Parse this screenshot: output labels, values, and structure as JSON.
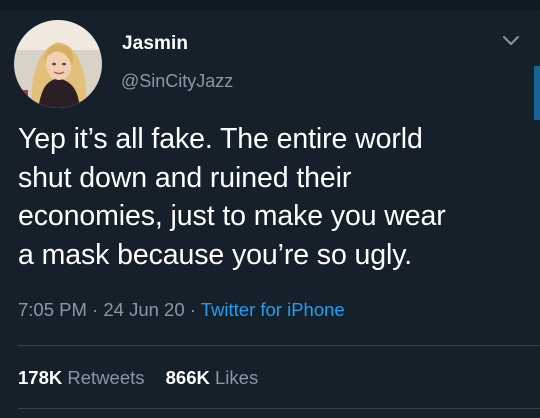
{
  "tweet": {
    "author": {
      "display_name": "Jasmin",
      "handle": "@SinCityJazz",
      "avatar_icon": "profile-photo"
    },
    "text_lines": [
      "Yep it’s all fake. The entire world",
      "shut down and ruined their",
      "economies, just to make you wear",
      "a mask because you’re so ugly."
    ],
    "time": "7:05 PM",
    "date": "24 Jun 20",
    "separator": "·",
    "source": "Twitter for iPhone",
    "retweets": {
      "count": "178K",
      "label": "Retweets"
    },
    "likes": {
      "count": "866K",
      "label": "Likes"
    },
    "more_icon": "chevron-down-icon"
  },
  "colors": {
    "background": "#15202b",
    "text": "#ffffff",
    "secondary": "#8899a6",
    "link": "#1da1f2",
    "divider": "#38444d"
  }
}
